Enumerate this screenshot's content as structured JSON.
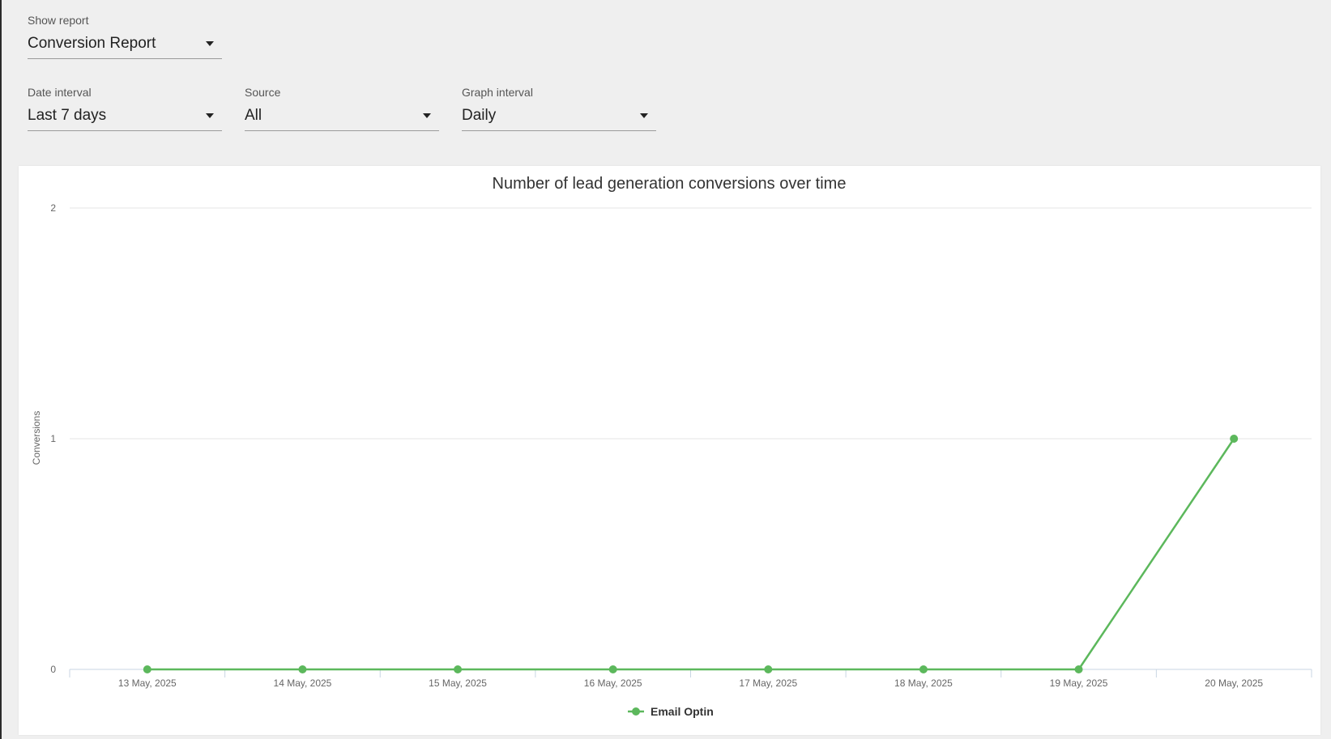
{
  "report_selector": {
    "label": "Show report",
    "value": "Conversion Report"
  },
  "filters": {
    "date_interval": {
      "label": "Date interval",
      "value": "Last 7 days"
    },
    "source": {
      "label": "Source",
      "value": "All"
    },
    "graph_interval": {
      "label": "Graph interval",
      "value": "Daily"
    }
  },
  "colors": {
    "series": "#5cb85c",
    "grid": "#e6e6e6",
    "axis": "#c9d6e3"
  },
  "chart_data": {
    "type": "line",
    "title": "Number of lead generation conversions over time",
    "ylabel": "Conversions",
    "xlabel": "",
    "categories": [
      "13 May, 2025",
      "14 May, 2025",
      "15 May, 2025",
      "16 May, 2025",
      "17 May, 2025",
      "18 May, 2025",
      "19 May, 2025",
      "20 May, 2025"
    ],
    "y_ticks": [
      "0",
      "1",
      "2"
    ],
    "ylim": [
      0,
      2
    ],
    "grid": true,
    "legend": "bottom-center",
    "series": [
      {
        "name": "Email Optin",
        "values": [
          0,
          0,
          0,
          0,
          0,
          0,
          0,
          1
        ]
      }
    ]
  }
}
